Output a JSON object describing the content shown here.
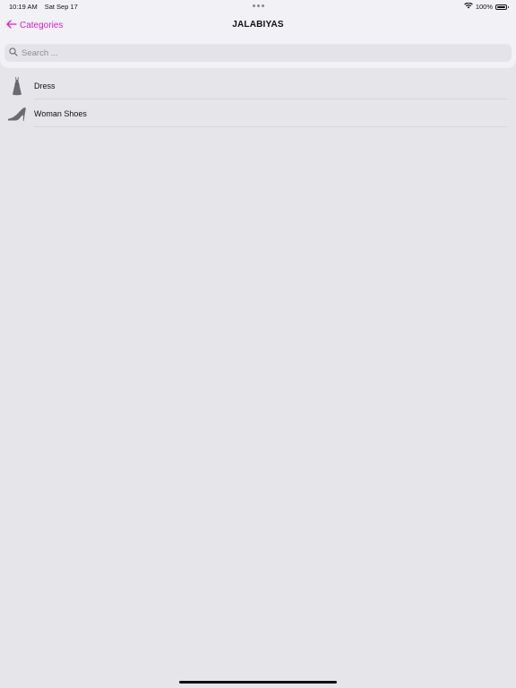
{
  "status_bar": {
    "time": "10:19 AM",
    "date": "Sat Sep 17",
    "battery": "100%"
  },
  "navigation": {
    "back_label": "Categories",
    "title": "JALABIYAS"
  },
  "search": {
    "placeholder": "Search ..."
  },
  "colors": {
    "accent": "#d41fc7",
    "background": "#e6e5ea",
    "header": "#f2f1f6"
  },
  "list": {
    "items": [
      {
        "label": "Dress",
        "icon": "dress-icon"
      },
      {
        "label": "Woman Shoes",
        "icon": "high-heel-shoe-icon"
      }
    ]
  }
}
